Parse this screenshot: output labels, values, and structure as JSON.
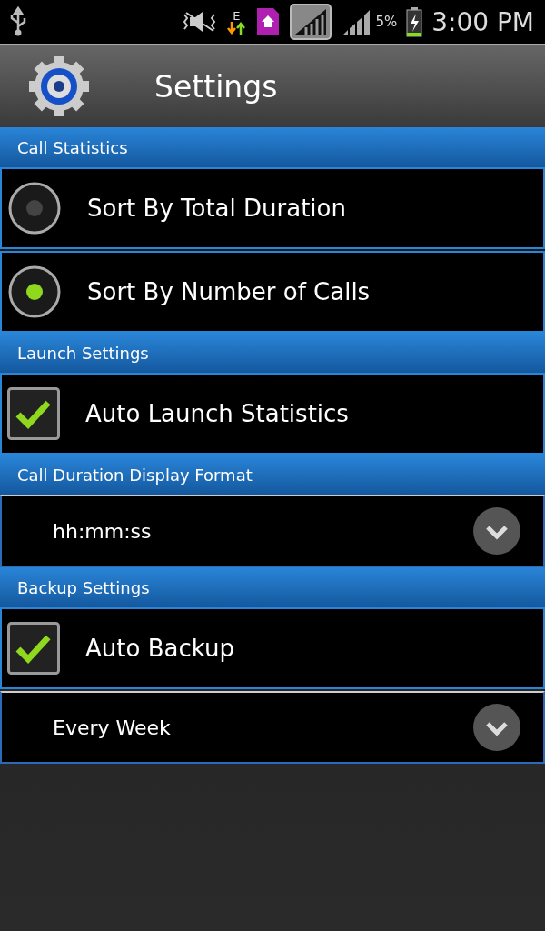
{
  "status_bar": {
    "network_type": "E",
    "battery": "5%",
    "time": "3:00 PM"
  },
  "header": {
    "title": "Settings"
  },
  "sections": [
    {
      "title": "Call Statistics",
      "items": [
        {
          "kind": "radio",
          "label": "Sort By Total Duration",
          "selected": false
        },
        {
          "kind": "radio",
          "label": "Sort By Number of Calls",
          "selected": true
        }
      ]
    },
    {
      "title": "Launch Settings",
      "items": [
        {
          "kind": "checkbox",
          "label": "Auto Launch Statistics",
          "checked": true
        }
      ]
    },
    {
      "title": "Call Duration Display Format",
      "items": [
        {
          "kind": "dropdown",
          "value": "hh:mm:ss"
        }
      ]
    },
    {
      "title": "Backup Settings",
      "items": [
        {
          "kind": "checkbox",
          "label": "Auto Backup",
          "checked": true
        },
        {
          "kind": "dropdown",
          "value": "Every Week"
        }
      ]
    }
  ]
}
